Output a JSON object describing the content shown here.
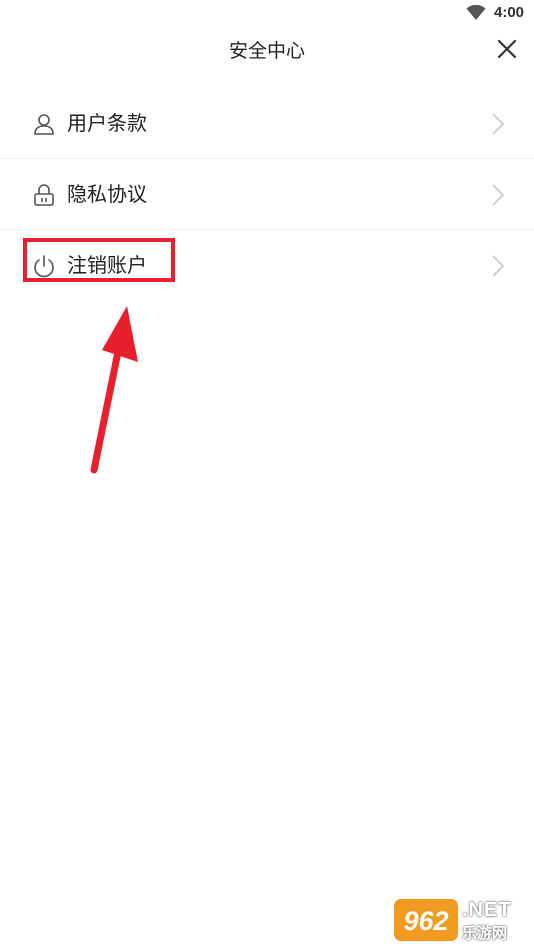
{
  "status_bar": {
    "time": "4:00",
    "wifi_icon": "wifi-icon"
  },
  "header": {
    "title": "安全中心",
    "close_icon": "close-icon"
  },
  "menu": {
    "items": [
      {
        "label": "用户条款",
        "icon": "user-icon"
      },
      {
        "label": "隐私协议",
        "icon": "lock-icon"
      },
      {
        "label": "注销账户",
        "icon": "power-icon"
      }
    ]
  },
  "annotation": {
    "highlight_color": "#e8202e"
  },
  "watermark": {
    "logo_number": "962",
    "logo_suffix": ".NET",
    "site_name": "乐游网"
  }
}
